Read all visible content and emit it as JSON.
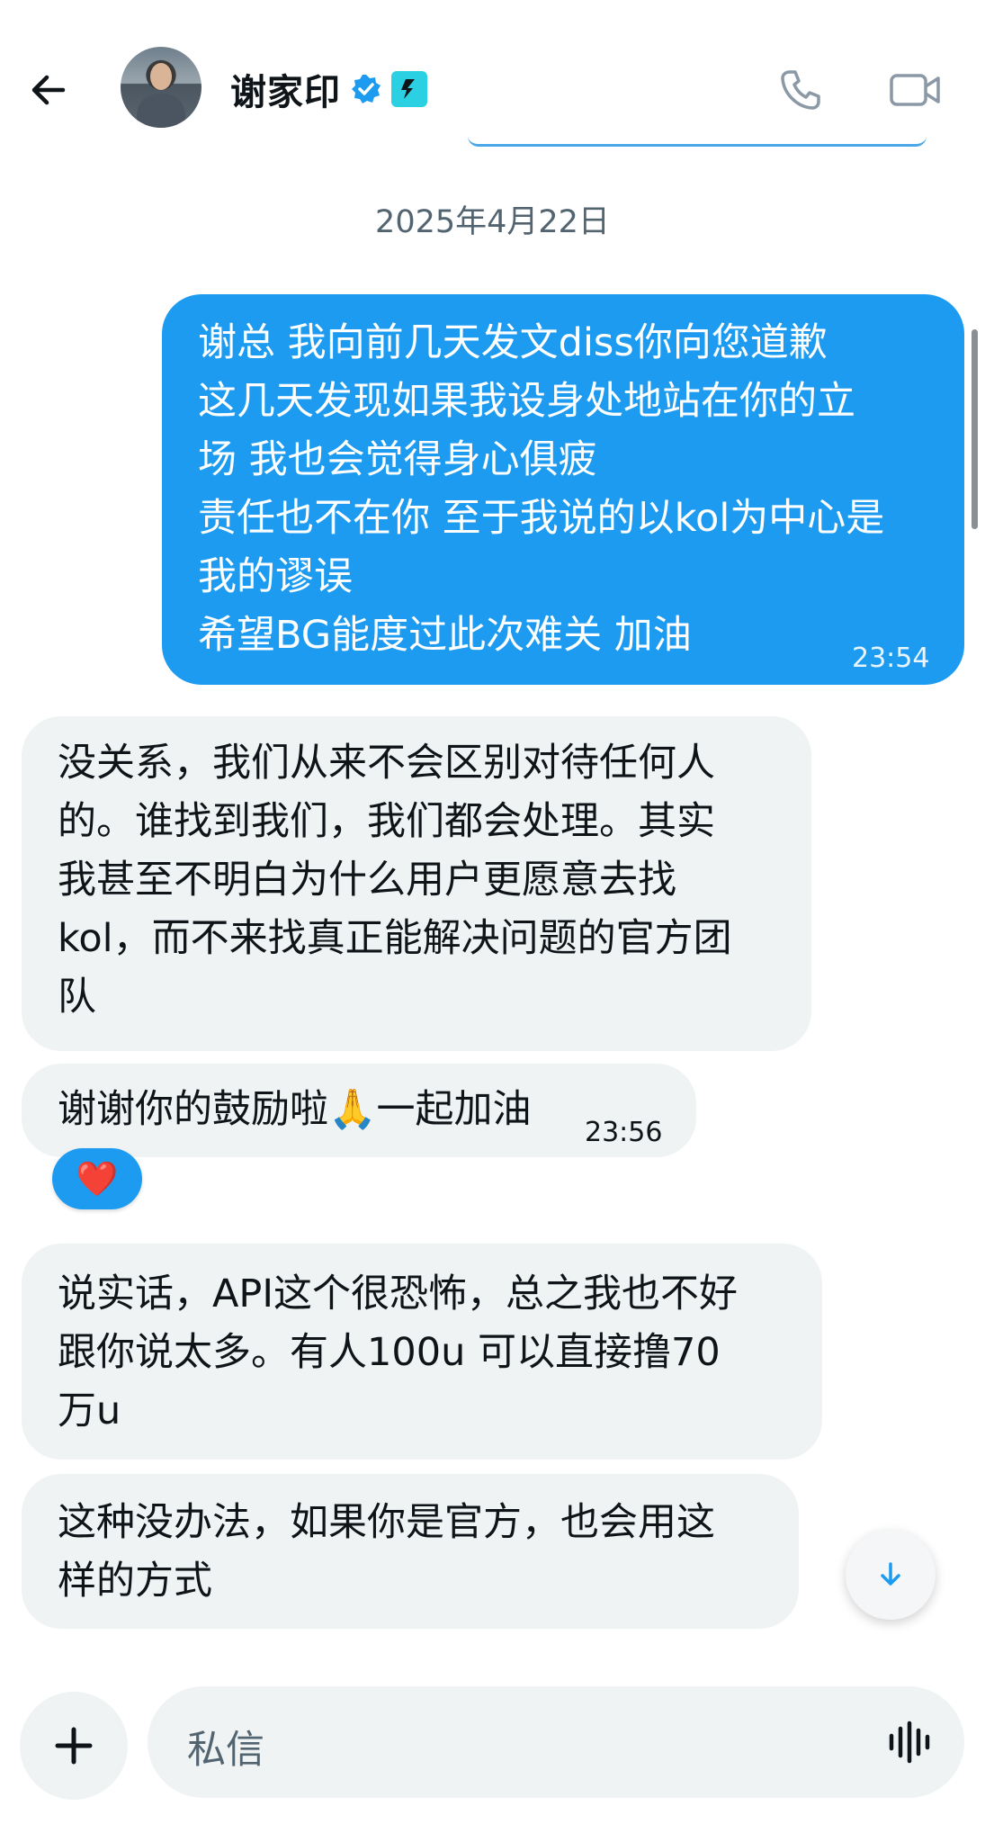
{
  "header": {
    "contact_name": "谢家印",
    "icons": {
      "back": "arrow-left-icon",
      "verified": "verified-badge-icon",
      "affiliation": "bitget-logo-icon",
      "call": "phone-icon",
      "video": "video-camera-icon"
    }
  },
  "conversation": {
    "date_separator": "2025年4月22日",
    "sent": {
      "lines": [
        "谢总 我向前几天发文diss你向您道歉",
        "这几天发现如果我设身处地站在你的立",
        "场 我也会觉得身心俱疲",
        "责任也不在你 至于我说的以kol为中心是",
        "我的谬误",
        "希望BG能度过此次难关 加油"
      ],
      "time": "23:54"
    },
    "received": [
      {
        "lines": [
          "没关系，我们从来不会区别对待任何人",
          "的。谁找到我们，我们都会处理。其实",
          "我甚至不明白为什么用户更愿意去找",
          "kol，而不来找真正能解决问题的官方团",
          "队"
        ]
      },
      {
        "text": "谢谢你的鼓励啦",
        "emoji": "🙏",
        "text_after": "一起加油",
        "time": "23:56",
        "reaction": "❤️"
      },
      {
        "lines": [
          "说实话，API这个很恐怖，总之我也不好",
          "跟你说太多。有人100u 可以直接撸70",
          "万u"
        ]
      },
      {
        "lines": [
          "这种没办法，如果你是官方，也会用这",
          "样的方式"
        ]
      }
    ]
  },
  "composer": {
    "placeholder": "私信",
    "icons": {
      "add": "plus-icon",
      "voice": "voice-waveform-icon",
      "scroll_down": "arrow-down-icon"
    }
  },
  "colors": {
    "sent_bubble": "#1d9bf0",
    "received_bubble": "#eff3f4",
    "verified_badge": "#1d9bf0",
    "affiliation_badge": "#2bd0e3"
  }
}
